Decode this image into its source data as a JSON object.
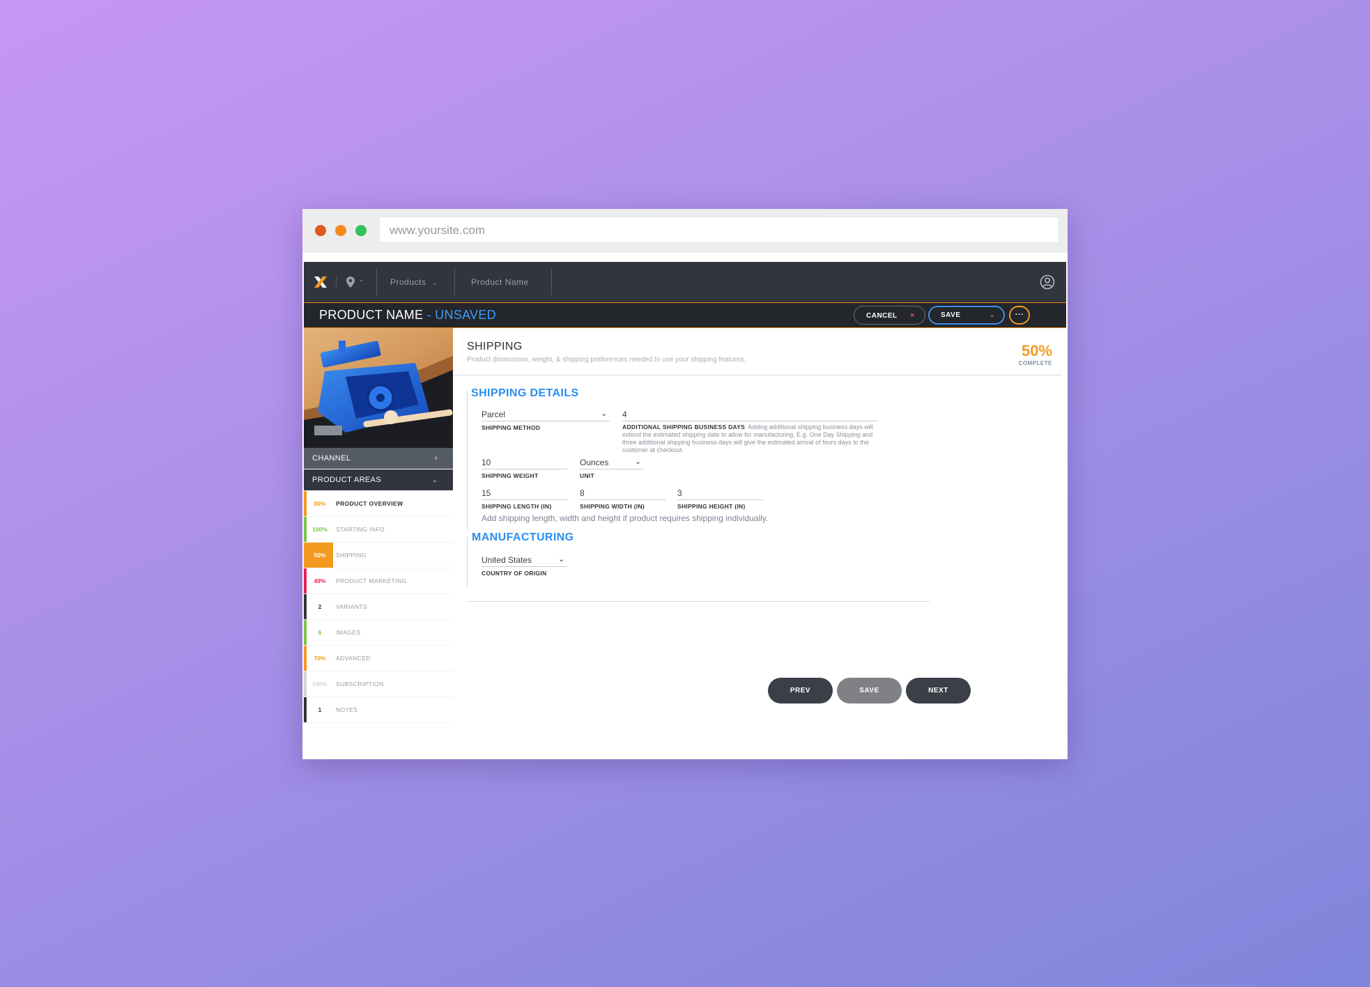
{
  "browser": {
    "url": "www.yoursite.com",
    "dot_colors": [
      "#e0581f",
      "#f28a1a",
      "#2fc35a"
    ]
  },
  "topnav": {
    "location_icon": "location-pin-icon",
    "products_label": "Products",
    "product_name_label": "Product Name",
    "user_icon": "user-circle-icon"
  },
  "titlebar": {
    "title": "PRODUCT NAME",
    "status": " - UNSAVED",
    "cancel_label": "CANCEL",
    "cancel_icon": "×",
    "save_label": "SAVE",
    "more_label": "···"
  },
  "sidebar": {
    "channel_label": "CHANNEL",
    "areas_label": "PRODUCT AREAS",
    "items": [
      {
        "pct": "80%",
        "label": "PRODUCT OVERVIEW",
        "color": "#f39a1f",
        "active": false,
        "label_dark": true
      },
      {
        "pct": "100%",
        "label": "STARTING INFO",
        "color": "#7cc545",
        "active": false,
        "label_dark": false
      },
      {
        "pct": "50%",
        "label": "SHIPPING",
        "color": "#f39a1f",
        "active": true,
        "label_dark": false
      },
      {
        "pct": "49%",
        "label": "PRODUCT MARKETING",
        "color": "#e52456",
        "active": false,
        "label_dark": false
      },
      {
        "pct": "2",
        "label": "VARIANTS",
        "color": "#31353d",
        "active": false,
        "label_dark": false
      },
      {
        "pct": "6",
        "label": "IMAGES",
        "color": "#7cc545",
        "active": false,
        "label_dark": false
      },
      {
        "pct": "70%",
        "label": "ADVANCED",
        "color": "#f39a1f",
        "active": false,
        "label_dark": false
      },
      {
        "pct": "100%",
        "label": "SUBSCRIPTION",
        "color": "#d4d4d4",
        "active": false,
        "label_dark": false
      },
      {
        "pct": "1",
        "label": "NOTES",
        "color": "#31353d",
        "active": false,
        "label_dark": false
      }
    ]
  },
  "main": {
    "section_title": "SHIPPING",
    "section_subtitle": "Product dimensions, weight, & shipping preferences needed to use your shipping features.",
    "complete_pct": "50%",
    "complete_label": "COMPLETE",
    "shipping_details_title": "SHIPPING DETAILS",
    "shipping_method_value": "Parcel",
    "shipping_method_label": "SHIPPING METHOD",
    "business_days_value": "4",
    "business_days_label": "ADDITIONAL SHIPPING BUSINESS DAYS",
    "business_days_help": "Adding additional shipping business days will extend the estimated shipping date to allow for manufacturing. E.g. One Day Shipping and three additional shipping business days will give the estimated arrival of fours days to the customer at checkout.",
    "weight_value": "10",
    "weight_label": "SHIPPING WEIGHT",
    "unit_value": "Ounces",
    "unit_label": "UNIT",
    "length_value": "15",
    "length_label": "SHIPPING LENGTH (IN)",
    "width_value": "8",
    "width_label": "SHIPPING WIDTH (IN)",
    "height_value": "3",
    "height_label": "SHIPPING HEIGHT (IN)",
    "dimensions_hint": "Add shipping length, width and height if product requires shipping individually.",
    "manufacturing_title": "MANUFACTURING",
    "country_value": "United States",
    "country_label": "COUNTRY OF ORIGIN",
    "prev_label": "PREV",
    "save_label": "SAVE",
    "next_label": "NEXT"
  },
  "colors": {
    "accent_orange": "#f39a1f",
    "accent_blue": "#2a8ef0",
    "nav_dark": "#31353d"
  }
}
